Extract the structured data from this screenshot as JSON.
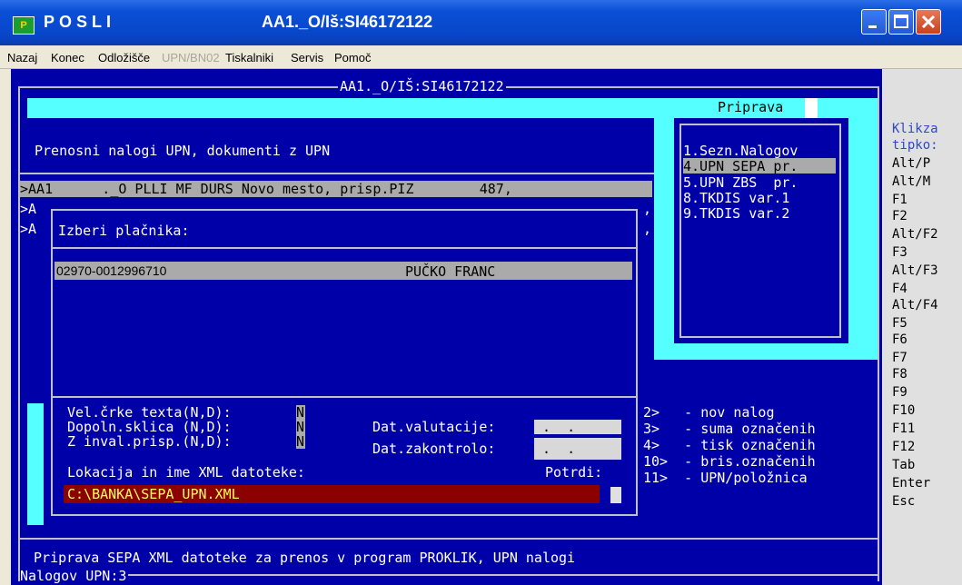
{
  "window": {
    "app_name": "POSLI",
    "title": "AA1._O/Iš:SI46172122",
    "icon_text": "P"
  },
  "menu": [
    {
      "label": "Nazaj",
      "enabled": true
    },
    {
      "label": "Konec",
      "enabled": true
    },
    {
      "label": "Odložišče",
      "enabled": true
    },
    {
      "label": "UPN/BN02",
      "enabled": false
    },
    {
      "label": "Tiskalniki",
      "enabled": true
    },
    {
      "label": "Servis",
      "enabled": true
    },
    {
      "label": "Pomoč",
      "enabled": true
    }
  ],
  "console": {
    "frame_title": "AA1._O/IŠ:SI46172122",
    "heading": "Prenosni nalogi UPN, dokumenti z UPN",
    "list_row1": ">AA1      ._O PLLI MF DURS Novo mesto, prisp.PIZ        487,",
    "list_row2": ">A",
    "list_row3": ">A",
    "footer_msg": " Priprava SEPA XML datoteke za prenos v program PROKLIK, UPN nalogi",
    "footer_count": "Nalogov UPN:3"
  },
  "priprava_menu": {
    "title": "Priprava",
    "items": [
      "1.Sezn.Nalogov",
      "4.UPN SEPA pr.",
      "5.UPN ZBS  pr.",
      "8.TKDIS var.1",
      "9.TKDIS var.2"
    ],
    "selected_index": 1
  },
  "payer_dialog": {
    "title": "Izberi plačnika:",
    "row_account": "02970-0012996710",
    "row_name": "PUČKO FRANC"
  },
  "options": {
    "font_size_label": "Vel.črke texta(N,D):",
    "font_size_value": "N",
    "ref_label": "Dopoln.sklica (N,D):",
    "ref_value": "N",
    "inval_label": "Z inval.prisp.(N,D):",
    "inval_value": "N",
    "date_value_label": "Dat.valutacije:",
    "date_value": " .  .",
    "date_check_label": "Dat.zakontrolo:",
    "date_check": " .  .",
    "xml_label": "Lokacija in ime XML datoteke:",
    "confirm_label": "Potrdi:",
    "xml_path": "C:\\BANKA\\SEPA_UPN.XML"
  },
  "actions": [
    "2>   - nov nalog",
    "3>   - suma označenih",
    "4>   - tisk označenih",
    "10>  - bris.označenih",
    "11>  - UPN/položnica"
  ],
  "side_panel": {
    "header1": "Klikza",
    "header2": "tipko:",
    "keys": [
      "Alt/P",
      "Alt/M",
      "F1",
      "F2",
      "Alt/F2",
      "F3",
      "Alt/F3",
      "F4",
      "Alt/F4",
      "F5",
      "F6",
      "F7",
      "F8",
      "F9",
      "F10",
      "F11",
      "F12",
      "Tab",
      "Enter",
      "Esc"
    ]
  },
  "colors": {
    "console_bg": "#0000a8",
    "highlight": "#55ffff",
    "selection": "#aaaaaa",
    "input_path_bg": "#8b0000"
  }
}
